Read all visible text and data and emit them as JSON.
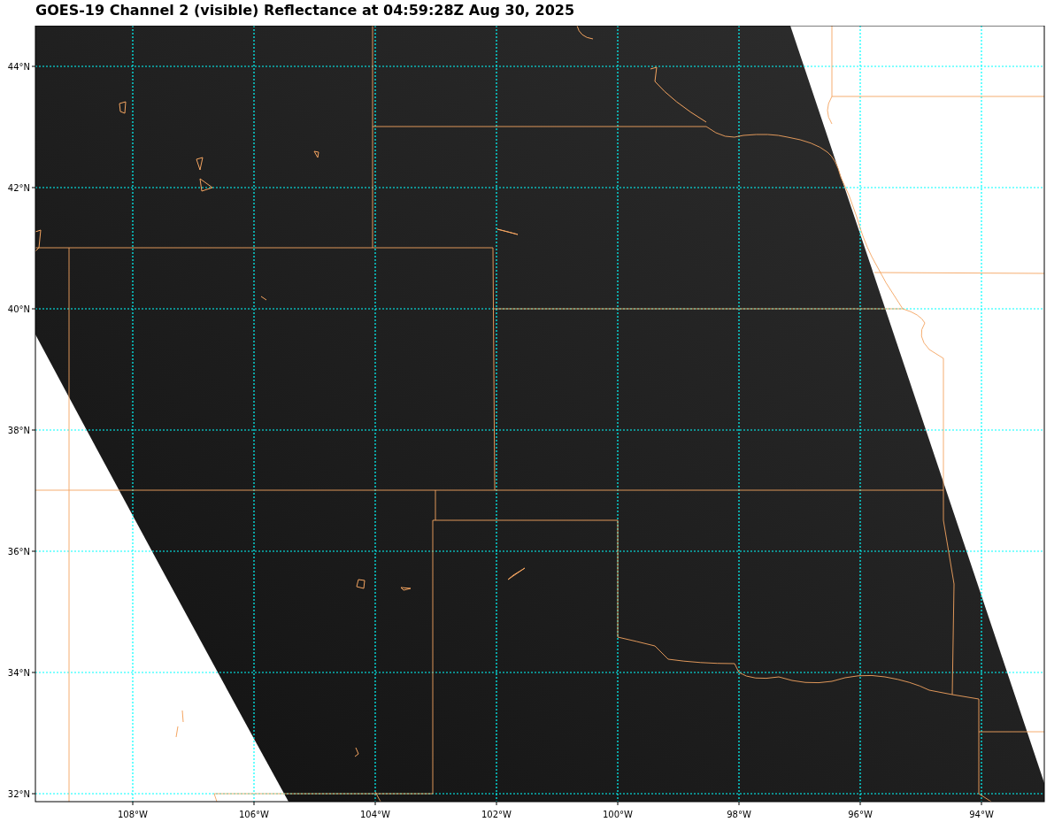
{
  "title": "GOES-19 Channel 2 (visible) Reflectance at 04:59:28Z Aug 30, 2025",
  "map": {
    "lat_labels": [
      "44°N",
      "42°N",
      "40°N",
      "38°N",
      "36°N",
      "34°N",
      "32°N"
    ],
    "lon_labels": [
      "108°W",
      "106°W",
      "104°W",
      "102°W",
      "100°W",
      "98°W",
      "96°W",
      "94°W"
    ]
  }
}
